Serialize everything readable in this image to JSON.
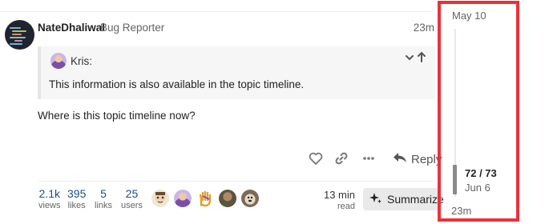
{
  "post": {
    "username": "NateDhaliwal",
    "user_title": "Bug Reporter",
    "age": "23m",
    "quote": {
      "author": "Kris:",
      "text": "This information is also available in the topic timeline."
    },
    "body": "Where is this topic timeline now?",
    "actions": {
      "reply_label": "Reply"
    }
  },
  "topic_map": {
    "stats": [
      {
        "value": "2.1k",
        "label": "views"
      },
      {
        "value": "395",
        "label": "likes"
      },
      {
        "value": "5",
        "label": "links"
      },
      {
        "value": "25",
        "label": "users"
      }
    ],
    "read_time": {
      "value": "13 min",
      "label": "read"
    },
    "summarize_label": "Summarize"
  },
  "timeline": {
    "start_date": "May 10",
    "position": "72 / 73",
    "current_date": "Jun 6",
    "end_age": "23m",
    "progress": 0.986
  },
  "colors": {
    "highlight": "#e8323a",
    "link_blue": "#1d4e89"
  },
  "icons": [
    "heart-icon",
    "link-icon",
    "more-icon",
    "reply-icon",
    "sparkle-icon",
    "chevron-down-icon",
    "arrow-up-icon"
  ]
}
